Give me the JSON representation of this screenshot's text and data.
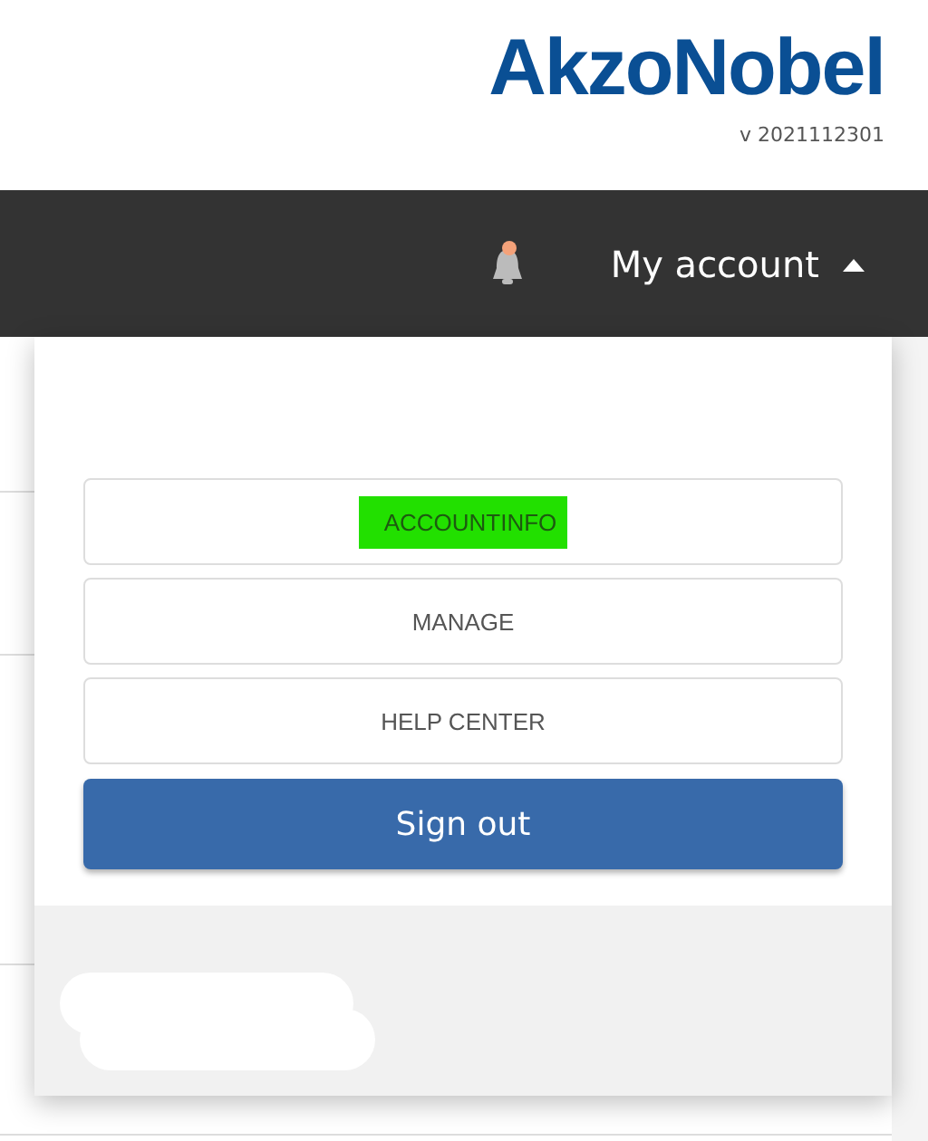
{
  "header": {
    "logo": "AkzoNobel",
    "version": "v 2021112301"
  },
  "navbar": {
    "notification_dot": true,
    "account_label": "My account",
    "account_expanded": true
  },
  "account_menu": {
    "items": [
      {
        "label": "ACCOUNTINFO",
        "highlighted": true
      },
      {
        "label": "MANAGE",
        "highlighted": false
      },
      {
        "label": "HELP CENTER",
        "highlighted": false
      }
    ],
    "sign_out": "Sign out"
  }
}
